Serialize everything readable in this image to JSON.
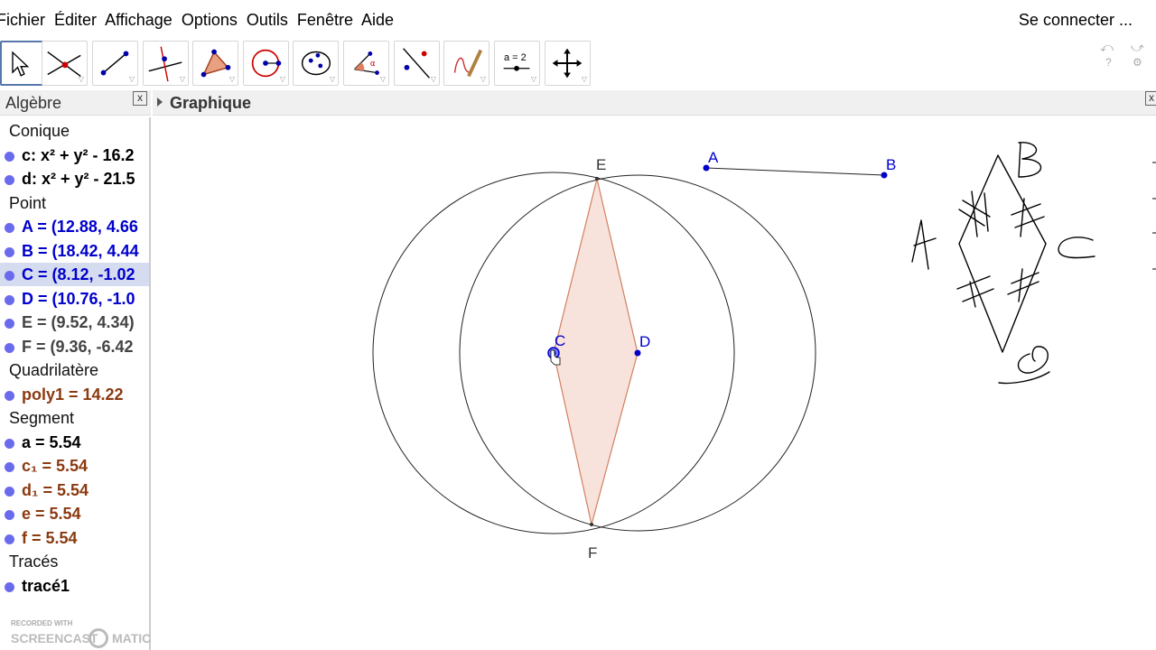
{
  "menu": {
    "items": [
      "Fichier",
      "Éditer",
      "Affichage",
      "Options",
      "Outils",
      "Fenêtre",
      "Aide"
    ],
    "login": "Se connecter ..."
  },
  "toolbar": {
    "tools": [
      {
        "name": "move-tool-icon",
        "active": true
      },
      {
        "name": "intersect-point-tool-icon",
        "active": false
      },
      {
        "name": "line-tool-icon",
        "active": false
      },
      {
        "name": "perpendicular-line-tool-icon",
        "active": false
      },
      {
        "name": "polygon-tool-icon",
        "active": false
      },
      {
        "name": "circle-tool-icon",
        "active": false
      },
      {
        "name": "conic-tool-icon",
        "active": false
      },
      {
        "name": "angle-tool-icon",
        "active": false
      },
      {
        "name": "reflect-tool-icon",
        "active": false
      },
      {
        "name": "freehand-tool-icon",
        "active": false
      },
      {
        "name": "slider-tool-icon",
        "active": false
      },
      {
        "name": "move-view-tool-icon",
        "active": false
      }
    ],
    "slider_label": "a = 2",
    "help": "?"
  },
  "algebra": {
    "title": "Algèbre",
    "close": "x",
    "rows": [
      {
        "type": "cat",
        "text": "Conique"
      },
      {
        "type": "item",
        "text": "c: x² + y² - 16.2",
        "color": "black"
      },
      {
        "type": "item",
        "text": "d: x² + y² - 21.5",
        "color": "black"
      },
      {
        "type": "cat",
        "text": "Point"
      },
      {
        "type": "item",
        "text": "A = (12.88, 4.66",
        "color": "blue"
      },
      {
        "type": "item",
        "text": "B = (18.42, 4.44",
        "color": "blue"
      },
      {
        "type": "item",
        "text": "C = (8.12, -1.02",
        "color": "blue",
        "selected": true
      },
      {
        "type": "item",
        "text": "D = (10.76, -1.0",
        "color": "blue"
      },
      {
        "type": "item",
        "text": "E = (9.52, 4.34)",
        "color": "gray"
      },
      {
        "type": "item",
        "text": "F = (9.36, -6.42",
        "color": "gray"
      },
      {
        "type": "cat",
        "text": "Quadrilatère"
      },
      {
        "type": "item",
        "text": "poly1 = 14.22",
        "color": "brown"
      },
      {
        "type": "cat",
        "text": "Segment"
      },
      {
        "type": "item",
        "text": "a = 5.54",
        "color": "black"
      },
      {
        "type": "item",
        "text": "c₁ = 5.54",
        "color": "brown"
      },
      {
        "type": "item",
        "text": "d₁ = 5.54",
        "color": "brown"
      },
      {
        "type": "item",
        "text": "e = 5.54",
        "color": "brown"
      },
      {
        "type": "item",
        "text": "f = 5.54",
        "color": "brown"
      },
      {
        "type": "cat",
        "text": "Tracés"
      },
      {
        "type": "item",
        "text": "tracé1",
        "color": "black"
      }
    ]
  },
  "graphics": {
    "title": "Graphique",
    "close": "x",
    "point_labels": {
      "A": "A",
      "B": "B",
      "C": "C",
      "D": "D",
      "E": "E",
      "F": "F"
    },
    "handwriting": {
      "A": "A",
      "B": "B",
      "C": "C",
      "D": "D"
    }
  },
  "watermark": {
    "small": "RECORDED WITH",
    "big": "SCREENCAST",
    "big2": "MATIC"
  }
}
